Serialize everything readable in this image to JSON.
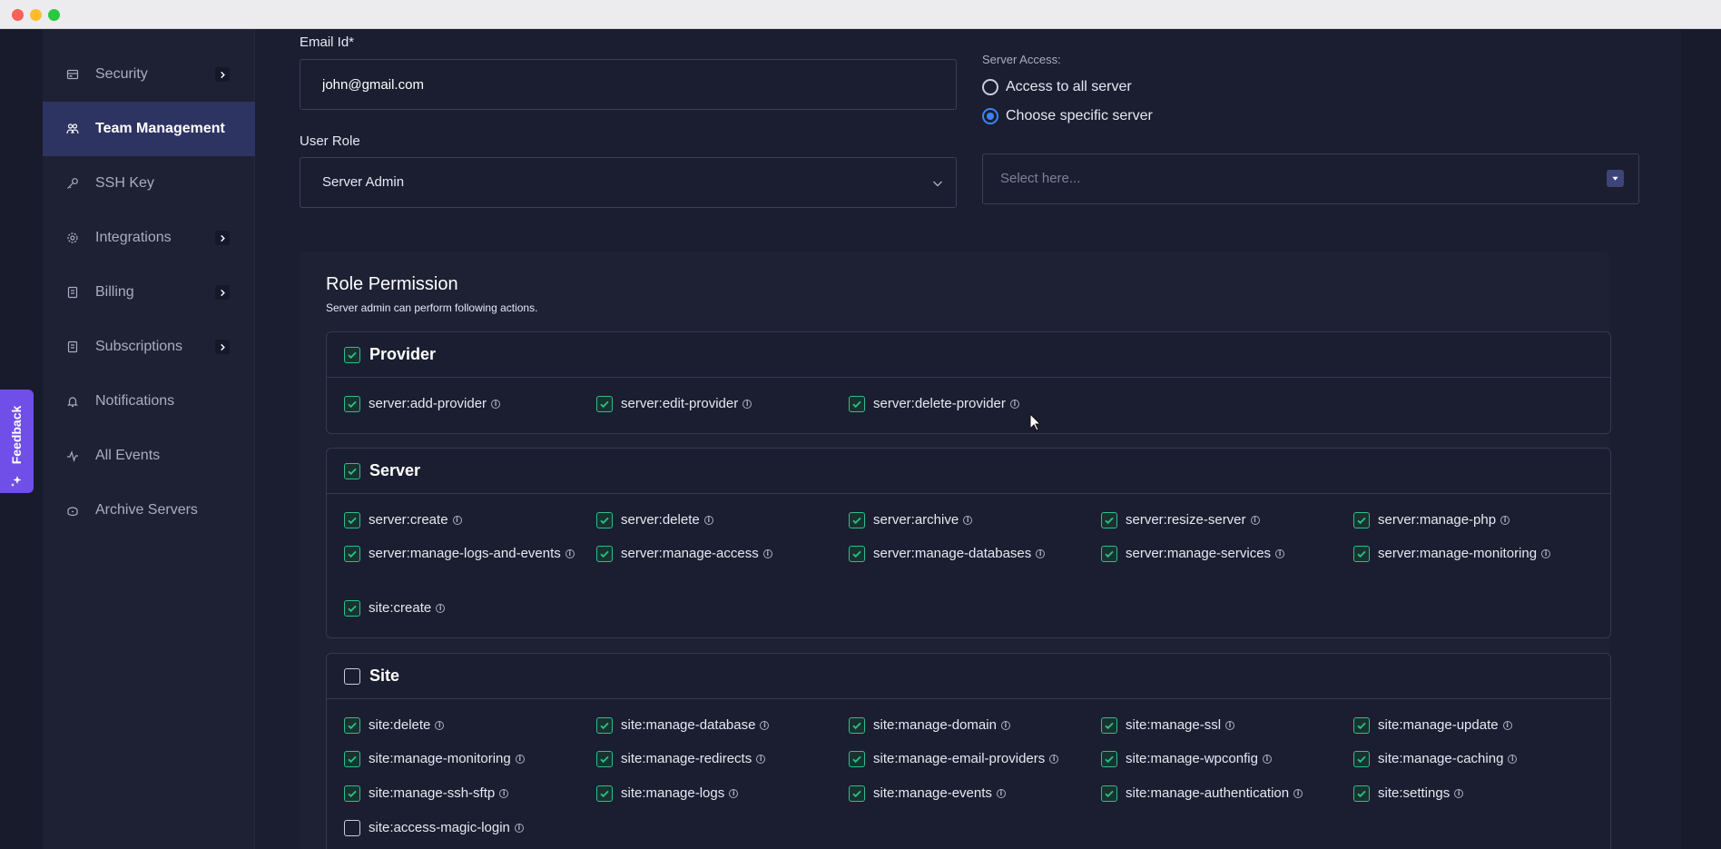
{
  "window": {
    "controls": [
      "close",
      "minimize",
      "maximize"
    ]
  },
  "sidebar": {
    "items": [
      {
        "label": "Security",
        "icon": "shield-icon",
        "has_submenu": true,
        "active": false
      },
      {
        "label": "Team Management",
        "icon": "team-icon",
        "has_submenu": false,
        "active": true
      },
      {
        "label": "SSH Key",
        "icon": "key-icon",
        "has_submenu": false,
        "active": false
      },
      {
        "label": "Integrations",
        "icon": "gear-icon",
        "has_submenu": true,
        "active": false
      },
      {
        "label": "Billing",
        "icon": "receipt-icon",
        "has_submenu": true,
        "active": false
      },
      {
        "label": "Subscriptions",
        "icon": "receipt-icon",
        "has_submenu": true,
        "active": false
      },
      {
        "label": "Notifications",
        "icon": "bell-icon",
        "has_submenu": false,
        "active": false
      },
      {
        "label": "All Events",
        "icon": "activity-icon",
        "has_submenu": false,
        "active": false
      },
      {
        "label": "Archive Servers",
        "icon": "archive-icon",
        "has_submenu": false,
        "active": false
      }
    ]
  },
  "feedback": {
    "label": "Feedback",
    "icon": "sparkle-icon"
  },
  "form": {
    "email_label": "Email Id*",
    "email_value": "john@gmail.com",
    "role_label": "User Role",
    "role_value": "Server Admin",
    "server_access_label": "Server Access:",
    "access_all_label": "Access to all server",
    "access_specific_label": "Choose specific server",
    "access_selected": "specific",
    "server_select_placeholder": "Select here..."
  },
  "permissions": {
    "title": "Role Permission",
    "subtitle": "Server admin can perform following actions.",
    "groups": [
      {
        "name": "Provider",
        "checked": true,
        "items": [
          {
            "label": "server:add-provider",
            "checked": true
          },
          {
            "label": "server:edit-provider",
            "checked": true
          },
          {
            "label": "server:delete-provider",
            "checked": true
          }
        ]
      },
      {
        "name": "Server",
        "checked": true,
        "items": [
          {
            "label": "server:create",
            "checked": true
          },
          {
            "label": "server:delete",
            "checked": true
          },
          {
            "label": "server:archive",
            "checked": true
          },
          {
            "label": "server:resize-server",
            "checked": true
          },
          {
            "label": "server:manage-php",
            "checked": true
          },
          {
            "label": "server:manage-logs-and-events",
            "checked": true
          },
          {
            "label": "server:manage-access",
            "checked": true
          },
          {
            "label": "server:manage-databases",
            "checked": true
          },
          {
            "label": "server:manage-services",
            "checked": true
          },
          {
            "label": "server:manage-monitoring",
            "checked": true
          },
          {
            "label": "site:create",
            "checked": true
          }
        ]
      },
      {
        "name": "Site",
        "checked": false,
        "items": [
          {
            "label": "site:delete",
            "checked": true
          },
          {
            "label": "site:manage-database",
            "checked": true
          },
          {
            "label": "site:manage-domain",
            "checked": true
          },
          {
            "label": "site:manage-ssl",
            "checked": true
          },
          {
            "label": "site:manage-update",
            "checked": true
          },
          {
            "label": "site:manage-monitoring",
            "checked": true
          },
          {
            "label": "site:manage-redirects",
            "checked": true
          },
          {
            "label": "site:manage-email-providers",
            "checked": true
          },
          {
            "label": "site:manage-wpconfig",
            "checked": true
          },
          {
            "label": "site:manage-caching",
            "checked": true
          },
          {
            "label": "site:manage-ssh-sftp",
            "checked": true
          },
          {
            "label": "site:manage-logs",
            "checked": true
          },
          {
            "label": "site:manage-events",
            "checked": true
          },
          {
            "label": "site:manage-authentication",
            "checked": true
          },
          {
            "label": "site:settings",
            "checked": true
          },
          {
            "label": "site:access-magic-login",
            "checked": false
          }
        ]
      }
    ]
  },
  "colors": {
    "accent": "#2d3462",
    "check": "#2ebd8f",
    "radio": "#3b82f6",
    "feedback": "#6f4fe8"
  }
}
